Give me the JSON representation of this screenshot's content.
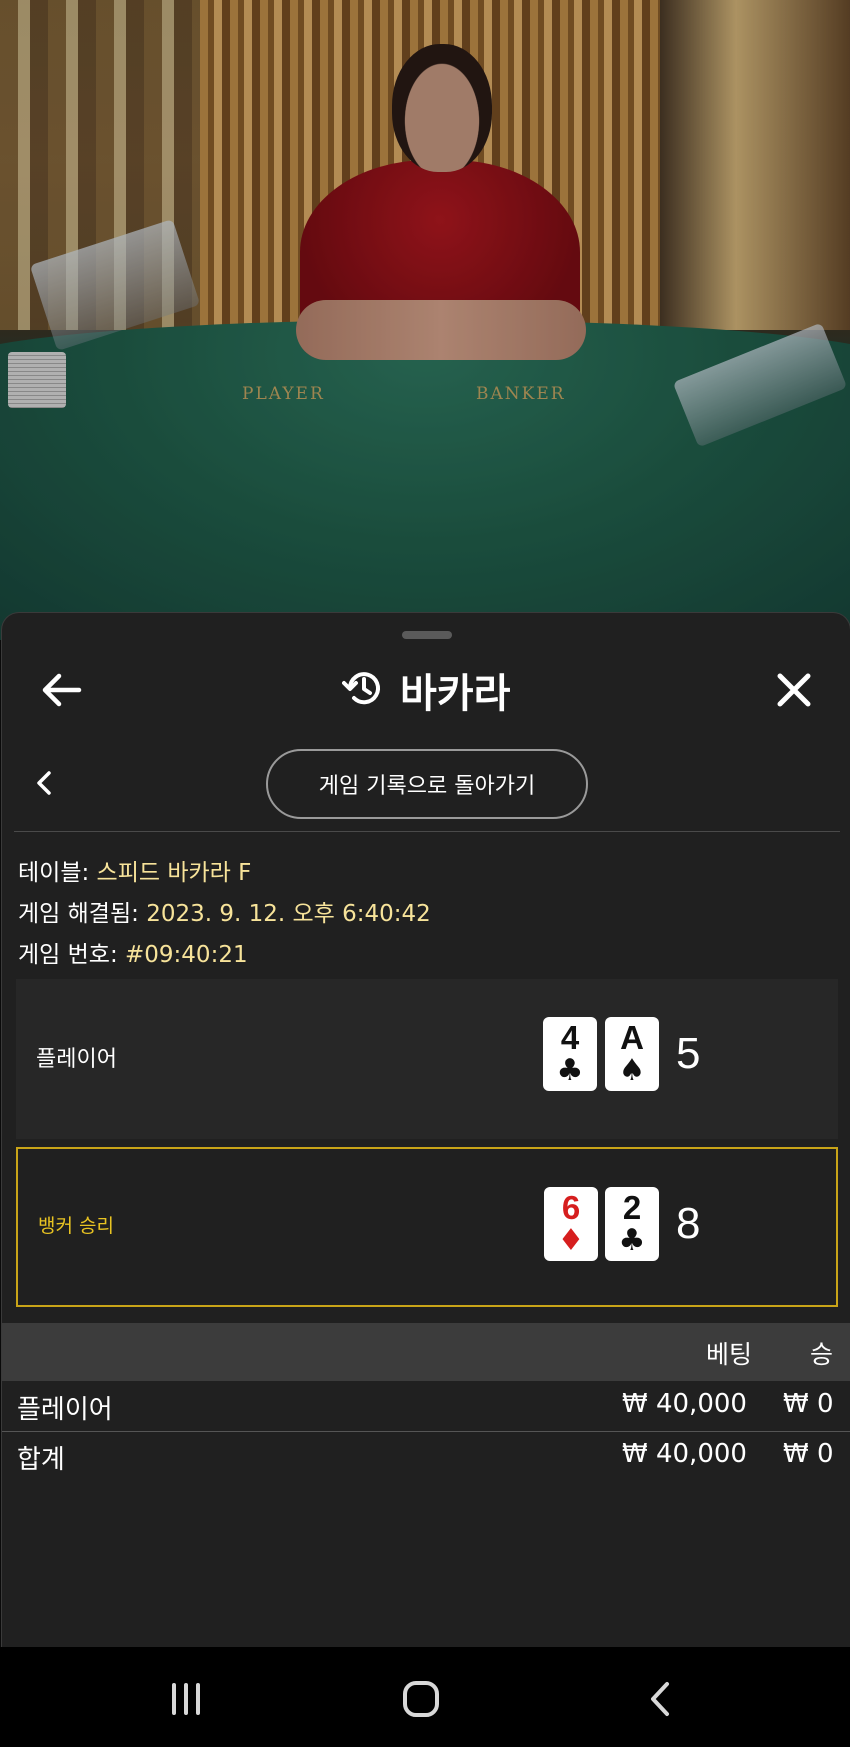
{
  "scene": {
    "felt_left_label": "PLAYER",
    "felt_right_label": "BANKER"
  },
  "header": {
    "title": "바카라",
    "back_icon": "arrow-left-icon",
    "history_icon": "history-icon",
    "close_icon": "close-icon"
  },
  "subnav": {
    "prev_icon": "chevron-left-icon",
    "back_to_history_label": "게임 기록으로 돌아가기"
  },
  "info": {
    "table_label": "테이블:",
    "table_value": "스피드 바카라 F",
    "resolved_label": "게임 해결됨:",
    "resolved_value": "2023. 9. 12. 오후 6:40:42",
    "game_no_label": "게임 번호:",
    "game_no_value": "#09:40:21"
  },
  "hands": [
    {
      "label": "플레이어",
      "cards": [
        {
          "rank": "4",
          "suit": "♣",
          "color": "#111111"
        },
        {
          "rank": "A",
          "suit": "♠",
          "color": "#111111"
        }
      ],
      "score": "5"
    },
    {
      "label": "뱅커 승리",
      "cards": [
        {
          "rank": "6",
          "suit": "♦",
          "color": "#d61e1e"
        },
        {
          "rank": "2",
          "suit": "♣",
          "color": "#111111"
        }
      ],
      "score": "8",
      "highlight_color": "#c9a418"
    }
  ],
  "bets_table": {
    "headers": [
      "베팅",
      "승"
    ],
    "rows": [
      {
        "name": "플레이어",
        "bet": "₩ 40,000",
        "win": "₩ 0"
      },
      {
        "name": "합계",
        "bet": "₩ 40,000",
        "win": "₩ 0"
      }
    ]
  },
  "nav": {
    "recents_icon": "recents-icon",
    "home_icon": "home-icon",
    "back_icon": "back-icon"
  }
}
